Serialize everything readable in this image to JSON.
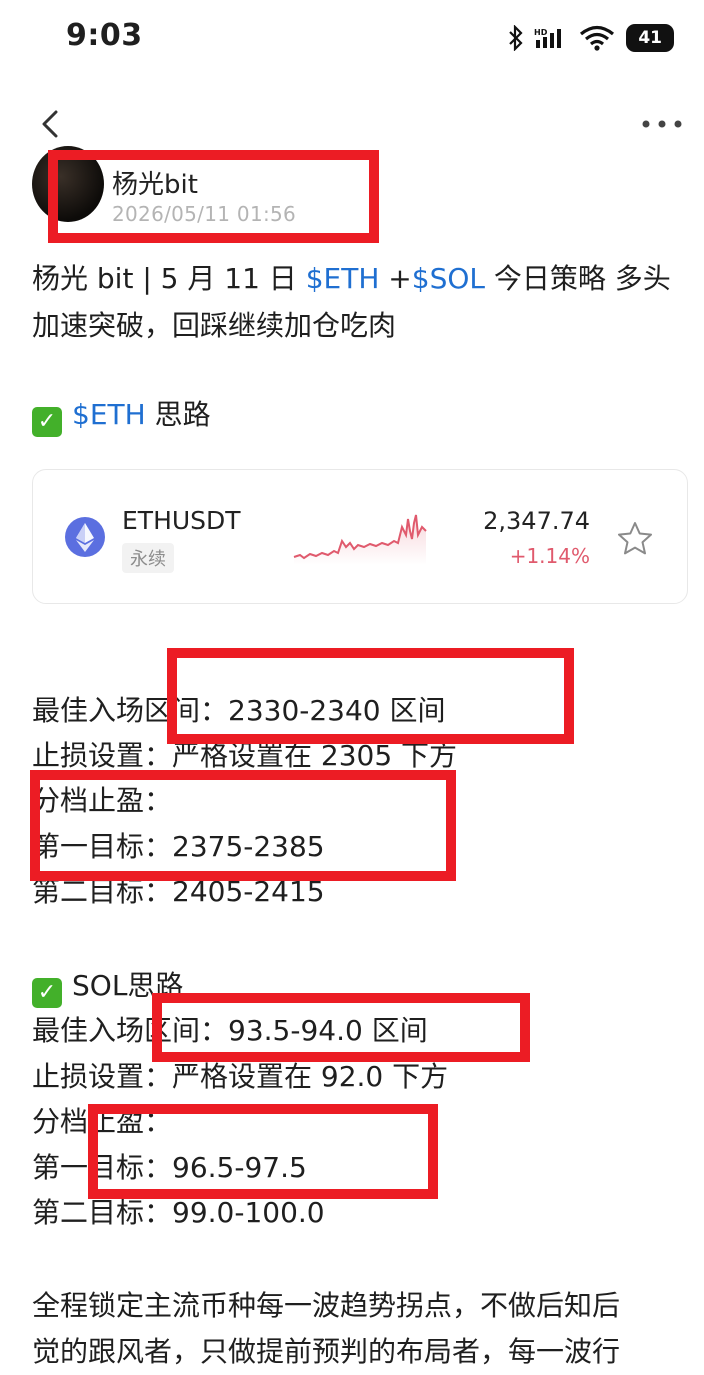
{
  "status_bar": {
    "time": "9:03",
    "battery": "41"
  },
  "post": {
    "author": "杨光bit",
    "timestamp": "2026/05/11 01:56",
    "title_line1_prefix": "杨光 bit | 5 月 11 日 ",
    "title_tag_eth": "$ETH",
    "title_plus": " +",
    "title_tag_sol": "$SOL",
    "title_line1_suffix": " 今日策略 多头",
    "title_line2": "加速突破，回踩继续加仓吃肉"
  },
  "eth_section": {
    "check": "✓",
    "tag": "$ETH",
    "heading_suffix": " 思路",
    "lines": [
      "最佳入场区间：2330-2340 区间",
      "止损设置：严格设置在 2305 下方",
      "分档止盈：",
      "第一目标：2375-2385",
      "第二目标：2405-2415"
    ]
  },
  "ticker_card": {
    "symbol": "ETHUSDT",
    "contract_type": "永续",
    "price": "2,347.74",
    "change": "+1.14%",
    "accent_down": "#e05a6d",
    "icon": "ethereum-icon"
  },
  "sol_section": {
    "check": "✓",
    "heading": "SOL思路",
    "lines": [
      "最佳入场区间：93.5-94.0 区间",
      "止损设置：严格设置在 92.0 下方",
      "分档止盈：",
      "第一目标：96.5-97.5",
      "第二目标：99.0-100.0"
    ]
  },
  "closing": {
    "line1": "全程锁定主流币种每一波趋势拐点，不做后知后",
    "line2": "觉的跟风者，只做提前预判的布局者，每一波行"
  },
  "colors": {
    "link": "#1f6fd1",
    "redaction": "#ec1c24",
    "check": "#43b02a"
  }
}
